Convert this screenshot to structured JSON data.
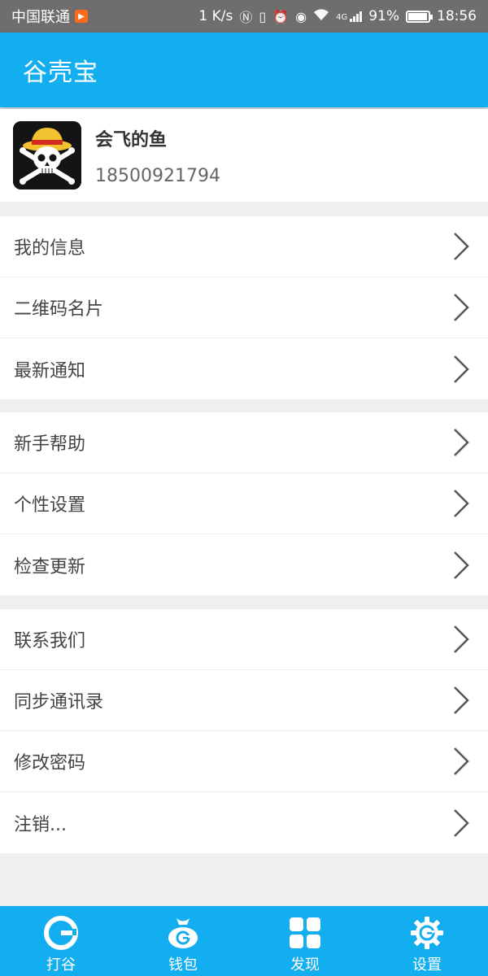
{
  "status_bar": {
    "carrier": "中国联通",
    "speed": "1 K/s",
    "signal": "4G",
    "battery": "91%",
    "time": "18:56"
  },
  "app_bar": {
    "title": "谷壳宝"
  },
  "profile": {
    "name": "会飞的鱼",
    "phone": "18500921794"
  },
  "menu_groups": [
    {
      "items": [
        {
          "label": "我的信息"
        },
        {
          "label": "二维码名片"
        },
        {
          "label": "最新通知"
        }
      ]
    },
    {
      "items": [
        {
          "label": "新手帮助"
        },
        {
          "label": "个性设置"
        },
        {
          "label": "检查更新"
        }
      ]
    },
    {
      "items": [
        {
          "label": "联系我们"
        },
        {
          "label": "同步通讯录"
        },
        {
          "label": "修改密码"
        },
        {
          "label": "注销..."
        }
      ]
    }
  ],
  "bottom_nav": {
    "items": [
      {
        "label": "打谷",
        "icon": "g-logo-icon"
      },
      {
        "label": "钱包",
        "icon": "wallet-bag-icon"
      },
      {
        "label": "发现",
        "icon": "grid-icon"
      },
      {
        "label": "设置",
        "icon": "gear-icon"
      }
    ]
  },
  "colors": {
    "primary": "#13aef0",
    "status_bar": "#6e6e6e",
    "background": "#efefef"
  }
}
